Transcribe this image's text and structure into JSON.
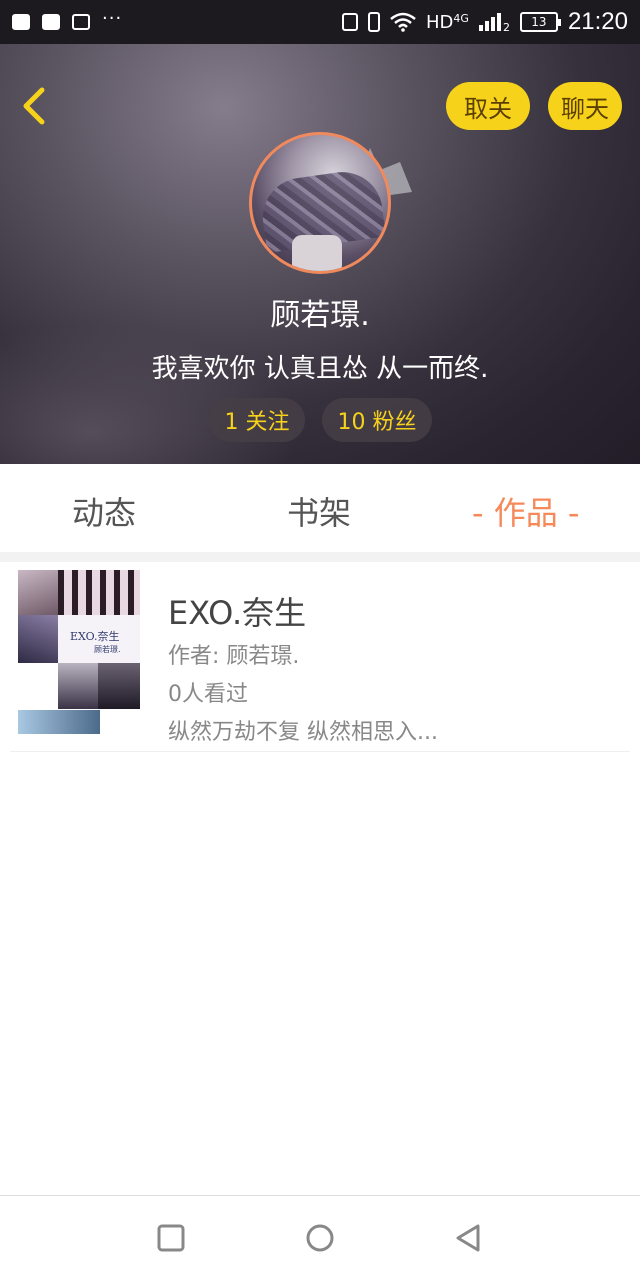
{
  "status_bar": {
    "network": "HD",
    "network_gen": "4G",
    "sim_index": "2",
    "battery": "13",
    "time": "21:20",
    "overflow": "···"
  },
  "header": {
    "unfollow_label": "取关",
    "chat_label": "聊天",
    "username": "顾若璟.",
    "bio": "我喜欢你 认真且怂 从一而终.",
    "following": "1 关注",
    "fans": "10 粉丝"
  },
  "tabs": [
    {
      "label": "动态",
      "active": false
    },
    {
      "label": "书架",
      "active": false
    },
    {
      "label": "- 作品 -",
      "active": true
    }
  ],
  "works": [
    {
      "title": "EXO.奈生",
      "author": "作者: 顾若璟.",
      "views": "0人看过",
      "description": "纵然万劫不复 纵然相思入...",
      "cover_title": "EXO.奈生",
      "cover_subtitle": "顾若璟."
    }
  ],
  "colors": {
    "accent_yellow": "#f7d21b",
    "active_tab": "#f5895a",
    "avatar_border": "#f08a5d"
  },
  "icons": {
    "back": "chevron-left-icon",
    "crown": "crown-icon",
    "nav_recent": "square-icon",
    "nav_home": "circle-icon",
    "nav_back": "triangle-left-icon"
  }
}
